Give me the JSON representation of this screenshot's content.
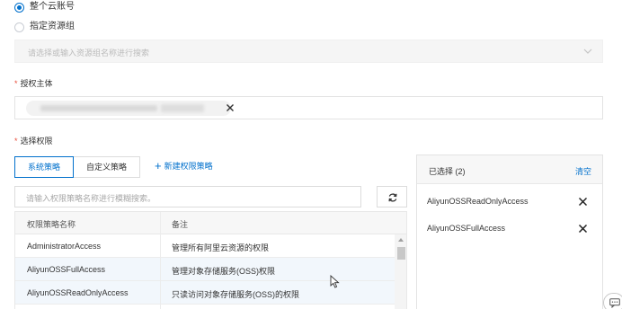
{
  "scope": {
    "options": [
      {
        "label": "整个云账号",
        "selected": true
      },
      {
        "label": "指定资源组",
        "selected": false
      }
    ],
    "resource_group_placeholder": "请选择或输入资源组名称进行搜索"
  },
  "principal": {
    "label": "授权主体",
    "required_mark": "*"
  },
  "permissions": {
    "label": "选择权限",
    "required_mark": "*",
    "tabs": [
      {
        "label": "系统策略",
        "active": true
      },
      {
        "label": "自定义策略",
        "active": false
      }
    ],
    "new_policy_plus": "+",
    "new_policy_label": "新建权限策略",
    "search_placeholder": "请输入权限策略名称进行模糊搜索。",
    "table": {
      "columns": [
        "权限策略名称",
        "备注"
      ],
      "rows": [
        {
          "name": "AdministratorAccess",
          "note": "管理所有阿里云资源的权限",
          "selected": false
        },
        {
          "name": "AliyunOSSFullAccess",
          "note": "管理对象存储服务(OSS)权限",
          "selected": true
        },
        {
          "name": "AliyunOSSReadOnlyAccess",
          "note": "只读访问对象存储服务(OSS)的权限",
          "selected": true
        }
      ]
    }
  },
  "selected_panel": {
    "title": "已选择 (2)",
    "clear_label": "清空",
    "items": [
      "AliyunOSSReadOnlyAccess",
      "AliyunOSSFullAccess"
    ]
  },
  "colors": {
    "accent": "#0070cc",
    "required": "#e84e3c",
    "selected_row": "#f2f7fc"
  },
  "icons": [
    "radio-selected-icon",
    "radio-unselected-icon",
    "chevron-down-icon",
    "close-icon",
    "plus-icon",
    "refresh-icon",
    "mouse-cursor-icon",
    "feedback-icon"
  ]
}
